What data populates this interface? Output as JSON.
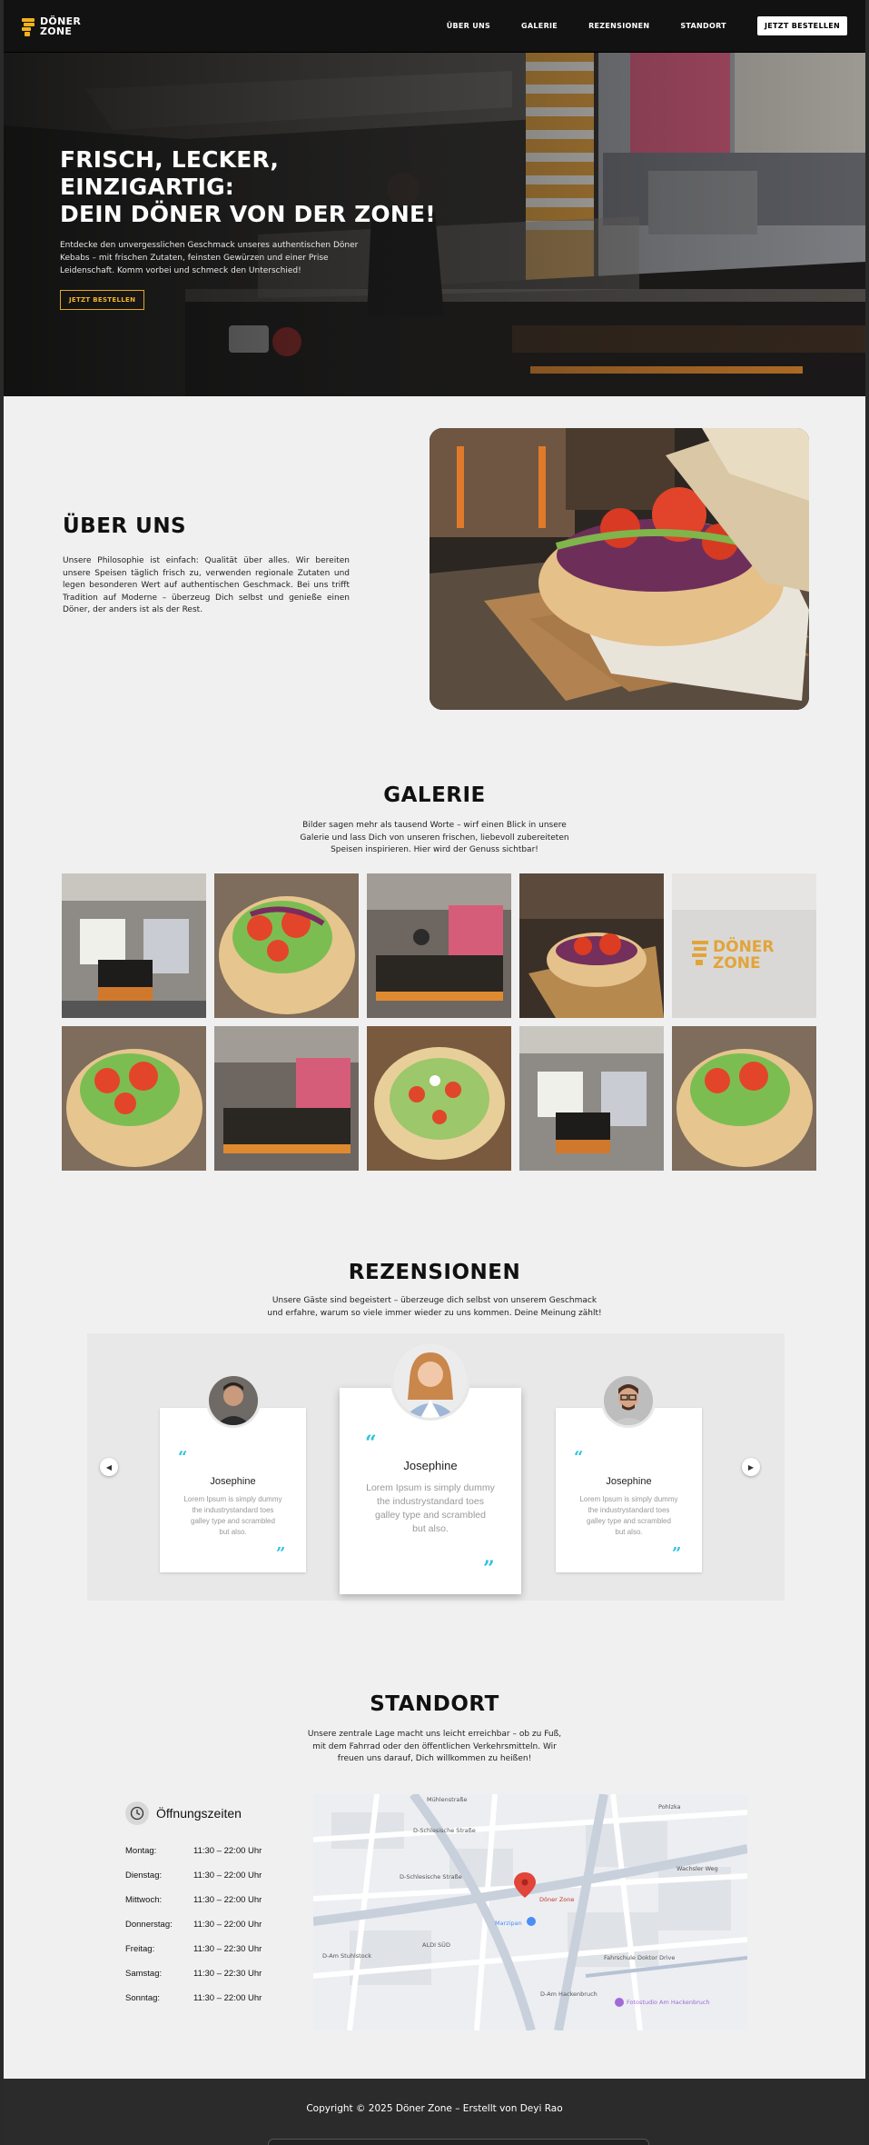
{
  "brand": {
    "line1": "DÖNER",
    "line2": "ZONE"
  },
  "nav": {
    "items": [
      {
        "label": "ÜBER UNS"
      },
      {
        "label": "GALERIE"
      },
      {
        "label": "REZENSIONEN"
      },
      {
        "label": "STANDORT"
      }
    ],
    "cta": "JETZT BESTELLEN"
  },
  "hero": {
    "title_line1": "FRISCH, LECKER, EINZIGARTIG:",
    "title_line2": "DEIN DÖNER VON DER ZONE!",
    "subtitle": "Entdecke den unvergesslichen Geschmack unseres authentischen Döner Kebabs – mit frischen Zutaten, feinsten Gewürzen und einer Prise Leidenschaft. Komm vorbei und schmeck den Unterschied!",
    "button": "JETZT BESTELLEN"
  },
  "about": {
    "title": "ÜBER UNS",
    "text": "Unsere Philosophie ist einfach: Qualität über alles. Wir bereiten unsere Speisen täglich frisch zu, verwenden regionale Zutaten und legen besonderen Wert auf authentischen Geschmack. Bei uns trifft Tradition auf Moderne – überzeug Dich selbst und genieße einen Döner, der anders ist als der Rest."
  },
  "gallery": {
    "title": "GALERIE",
    "subtitle_line1": "Bilder sagen mehr als tausend Worte – wirf einen Blick in unsere",
    "subtitle_line2": "Galerie und lass Dich von unseren frischen, liebevoll zubereiteten",
    "subtitle_line3": "Speisen inspirieren. Hier wird der Genuss sichtbar!",
    "sign_line1": "DÖNER",
    "sign_line2": "ZONE"
  },
  "reviews": {
    "title": "REZENSIONEN",
    "subtitle_line1": "Unsere Gäste sind begeistert – überzeuge dich selbst von unserem Geschmack",
    "subtitle_line2": "und erfahre, warum so viele immer wieder zu uns kommen. Deine Meinung zählt!",
    "items": [
      {
        "name": "Josephine",
        "text_line1": "Lorem Ipsum is simply dummy",
        "text_line2": "the industrystandard toes",
        "text_line3": "galley type and scrambled",
        "text_line4": "but also."
      },
      {
        "name": "Josephine",
        "text_line1": "Lorem Ipsum is simply dummy",
        "text_line2": "the industrystandard toes",
        "text_line3": "galley type and scrambled",
        "text_line4": "but also."
      },
      {
        "name": "Josephine",
        "text_line1": "Lorem Ipsum is simply dummy",
        "text_line2": "the industrystandard toes",
        "text_line3": "galley type and scrambled",
        "text_line4": "but also."
      }
    ],
    "open_quote": "“",
    "close_quote": "”",
    "prev": "◀",
    "next": "▶"
  },
  "location": {
    "title": "STANDORT",
    "subtitle_line1": "Unsere zentrale Lage macht uns leicht erreichbar – ob zu Fuß,",
    "subtitle_line2": "mit dem Fahrrad oder den öffentlichen Verkehrsmitteln. Wir",
    "subtitle_line3": "freuen uns darauf, Dich willkommen zu heißen!",
    "hours_title": "Öffnungszeiten",
    "hours": [
      {
        "day": "Montag:",
        "time": "11:30 – 22:00 Uhr"
      },
      {
        "day": "Dienstag:",
        "time": "11:30 – 22:00 Uhr"
      },
      {
        "day": "Mittwoch:",
        "time": "11:30 – 22:00 Uhr"
      },
      {
        "day": "Donnerstag:",
        "time": "11:30 – 22:00 Uhr"
      },
      {
        "day": "Freitag:",
        "time": "11:30 – 22:30 Uhr"
      },
      {
        "day": "Samstag:",
        "time": "11:30 – 22:30 Uhr"
      },
      {
        "day": "Sonntag:",
        "time": "11:30 – 22:00 Uhr"
      }
    ],
    "map": {
      "pin_label": "Döner Zone",
      "labels": {
        "schlesische_1": "D-Schlesische Straße",
        "schlesische_2": "D-Schlesische Straße",
        "muehlenstrasse": "Mühlenstraße",
        "wachsler": "Wachsler Weg",
        "hackenbruch": "D-Am Hackenbruch",
        "alddi": "ALDI SÜD",
        "marzipan": "Marzipan",
        "pohlzka": "Pohlzka",
        "fahrschule": "Fahrschule Doktor Drive",
        "fotostudio": "Fotostudio Am Hackenbruch",
        "stuhlstock": "D-Am Stuhlstock"
      }
    }
  },
  "footer": {
    "text": "Copyright © 2025 Döner Zone – Erstellt von Deyi Rao"
  },
  "colors": {
    "accent": "#f3b21c",
    "quote": "#2ec2dd",
    "dark": "#121212",
    "background": "#f0f0f0"
  }
}
